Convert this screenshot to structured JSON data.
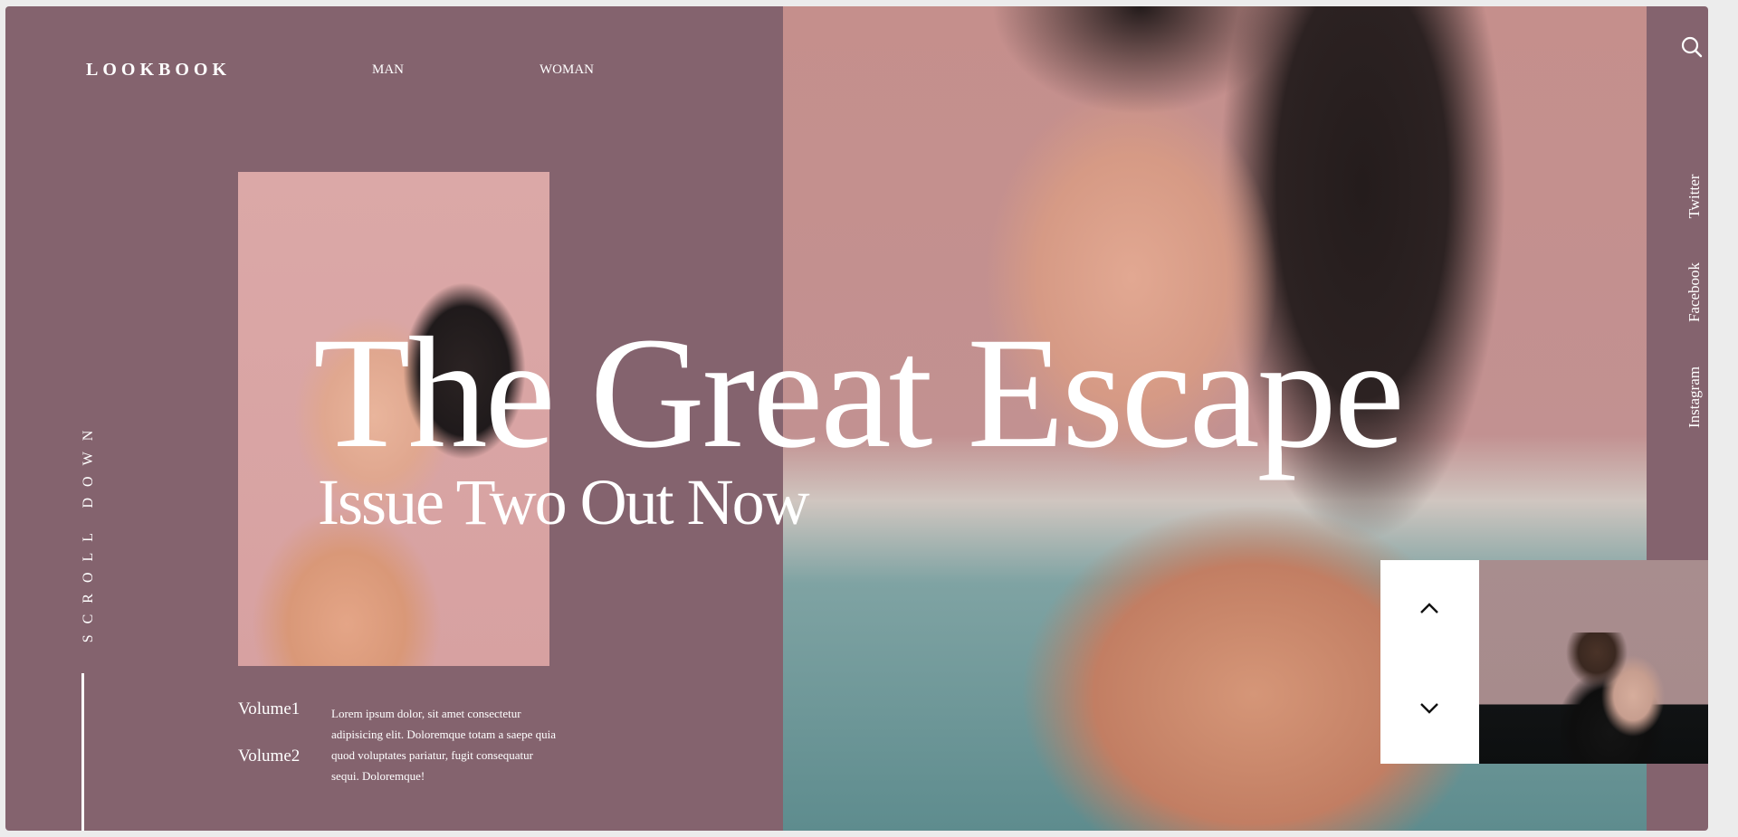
{
  "header": {
    "brand": "LOOKBOOK",
    "nav": [
      {
        "label": "MAN"
      },
      {
        "label": "WOMAN"
      }
    ]
  },
  "hero": {
    "title": "The Great Escape",
    "subtitle": "Issue Two Out Now"
  },
  "sidebar": {
    "search_icon": "search-icon",
    "social": [
      {
        "label": "Twitter"
      },
      {
        "label": "Facebook"
      },
      {
        "label": "Instagram"
      }
    ]
  },
  "scroll": {
    "label": "SCROLL DOWN"
  },
  "volumes": [
    {
      "label": "Volume1"
    },
    {
      "label": "Volume2"
    }
  ],
  "description": "Lorem ipsum dolor, sit amet consectetur adipisicing elit. Doloremque totam a saepe quia quod voluptates pariatur, fugit consequatur sequi. Doloremque!",
  "slider": {
    "up_icon": "chevron-up-icon",
    "down_icon": "chevron-down-icon"
  },
  "colors": {
    "background": "#84636e",
    "text": "#ffffff"
  }
}
